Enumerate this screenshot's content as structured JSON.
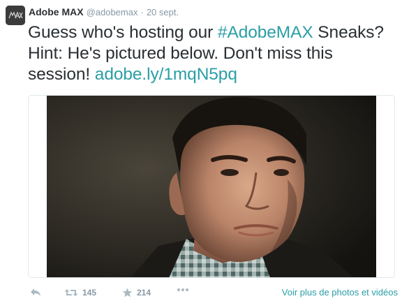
{
  "tweet": {
    "author": {
      "fullname": "Adobe MAX",
      "username": "@adobemax",
      "avatar_icon": "adobe-max-logo"
    },
    "separator": "·",
    "timestamp": "20 sept.",
    "text_parts": {
      "line1_before": "Guess who's hosting our ",
      "hashtag": "#AdobeMAX",
      "middle": " Sneaks? Hint: He's pictured below. Don't miss this session! ",
      "link": "adobe.ly/1mqN5pq"
    },
    "media": {
      "type": "photo"
    },
    "actions": {
      "reply_icon": "reply-icon",
      "retweet_count": "145",
      "favorite_count": "214",
      "more_icon": "ellipsis-icon",
      "view_more_label": "Voir plus de photos et vidéos"
    },
    "colors": {
      "link": "#2b9ea6",
      "text": "#292f33",
      "muted": "#8899a6",
      "icon": "#aab8c2"
    }
  }
}
